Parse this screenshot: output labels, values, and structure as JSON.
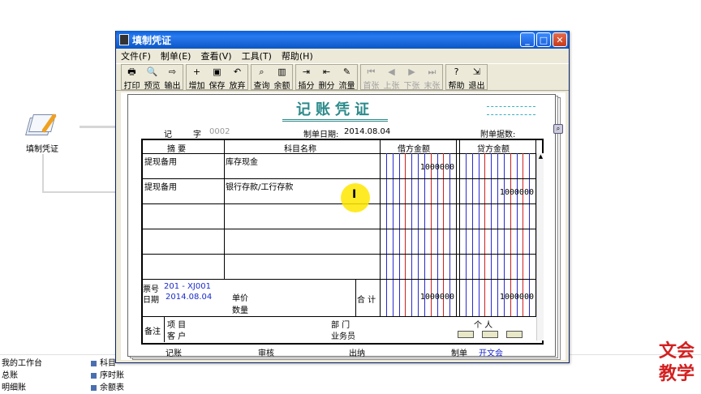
{
  "background": {
    "flow_node_label": "填制凭证",
    "bottom_items_col1": [
      "我的工作台",
      "总账",
      "明细账"
    ],
    "bottom_items_col2": [
      "科目",
      "序时账",
      "余额表"
    ],
    "watermark": [
      "文会",
      "教学"
    ]
  },
  "window": {
    "title": "填制凭证",
    "buttons": {
      "minimize": "_",
      "maximize": "□",
      "close": "✕"
    }
  },
  "menu": [
    "文件(F)",
    "制单(E)",
    "查看(V)",
    "工具(T)",
    "帮助(H)"
  ],
  "toolbar": {
    "groups": [
      [
        {
          "label": "打印",
          "icon": "printer-icon",
          "glyph": "🖶",
          "enabled": true
        },
        {
          "label": "预览",
          "icon": "preview-icon",
          "glyph": "🔍",
          "enabled": true
        },
        {
          "label": "输出",
          "icon": "export-icon",
          "glyph": "⇨",
          "enabled": true
        }
      ],
      [
        {
          "label": "增加",
          "icon": "add-icon",
          "glyph": "+",
          "enabled": true
        },
        {
          "label": "保存",
          "icon": "save-icon",
          "glyph": "▣",
          "enabled": true
        },
        {
          "label": "放弃",
          "icon": "undo-icon",
          "glyph": "↶",
          "enabled": true
        }
      ],
      [
        {
          "label": "查询",
          "icon": "binoculars-icon",
          "glyph": "⌕",
          "enabled": true
        },
        {
          "label": "余额",
          "icon": "balance-chart-icon",
          "glyph": "▥",
          "enabled": true
        }
      ],
      [
        {
          "label": "插分",
          "icon": "insert-row-icon",
          "glyph": "⇥",
          "enabled": true
        },
        {
          "label": "删分",
          "icon": "delete-row-icon",
          "glyph": "⇤",
          "enabled": true
        },
        {
          "label": "流量",
          "icon": "cashflow-icon",
          "glyph": "✎",
          "enabled": true
        }
      ],
      [
        {
          "label": "首张",
          "icon": "first-icon",
          "glyph": "⏮",
          "enabled": false
        },
        {
          "label": "上张",
          "icon": "prev-icon",
          "glyph": "◀",
          "enabled": false
        },
        {
          "label": "下张",
          "icon": "next-icon",
          "glyph": "▶",
          "enabled": false
        },
        {
          "label": "末张",
          "icon": "last-icon",
          "glyph": "⏭",
          "enabled": false
        }
      ],
      [
        {
          "label": "帮助",
          "icon": "help-icon",
          "glyph": "?",
          "enabled": true
        },
        {
          "label": "退出",
          "icon": "exit-icon",
          "glyph": "⇲",
          "enabled": true
        }
      ]
    ]
  },
  "voucher": {
    "title": "记账凭证",
    "type_label": "记",
    "number_label": "字",
    "number_value": "0002",
    "date_label": "制单日期:",
    "date_value": "2014.08.04",
    "attachments_label": "附单据数:",
    "columns": {
      "summary": "摘 要",
      "account": "科目名称",
      "debit": "借方金额",
      "credit": "贷方金额"
    },
    "rows": [
      {
        "summary": "提现备用",
        "account": "库存现金",
        "debit": "1000000",
        "credit": ""
      },
      {
        "summary": "提现备用",
        "account": "银行存款/工行存款",
        "debit": "",
        "credit": "1000000"
      },
      {
        "summary": "",
        "account": "",
        "debit": "",
        "credit": ""
      },
      {
        "summary": "",
        "account": "",
        "debit": "",
        "credit": ""
      },
      {
        "summary": "",
        "account": "",
        "debit": "",
        "credit": ""
      }
    ],
    "ticket_label": "票号",
    "ticket_value": "201 - XJ001",
    "ticket_date_label": "日期",
    "ticket_date_value": "2014.08.04",
    "unit_price_label": "单价",
    "quantity_label": "数量",
    "total_label": "合 计",
    "total_debit": "1000000",
    "total_credit": "1000000",
    "remarks_label": "备注",
    "project_label": "项  目",
    "customer_label": "客  户",
    "department_label": "部  门",
    "person_label": "个  人",
    "salesman_label": "业务员",
    "footer": {
      "bookkeeping": "记账",
      "audit": "审核",
      "cashier": "出纳",
      "maker_label": "制单",
      "maker_value": "开文会"
    }
  },
  "colors": {
    "titlebar": "#0b56c6",
    "voucher_title": "#2a8a8a",
    "blue_text": "#1a2ac8",
    "money_blue": "#2a2ad0",
    "money_red": "#d02020"
  }
}
